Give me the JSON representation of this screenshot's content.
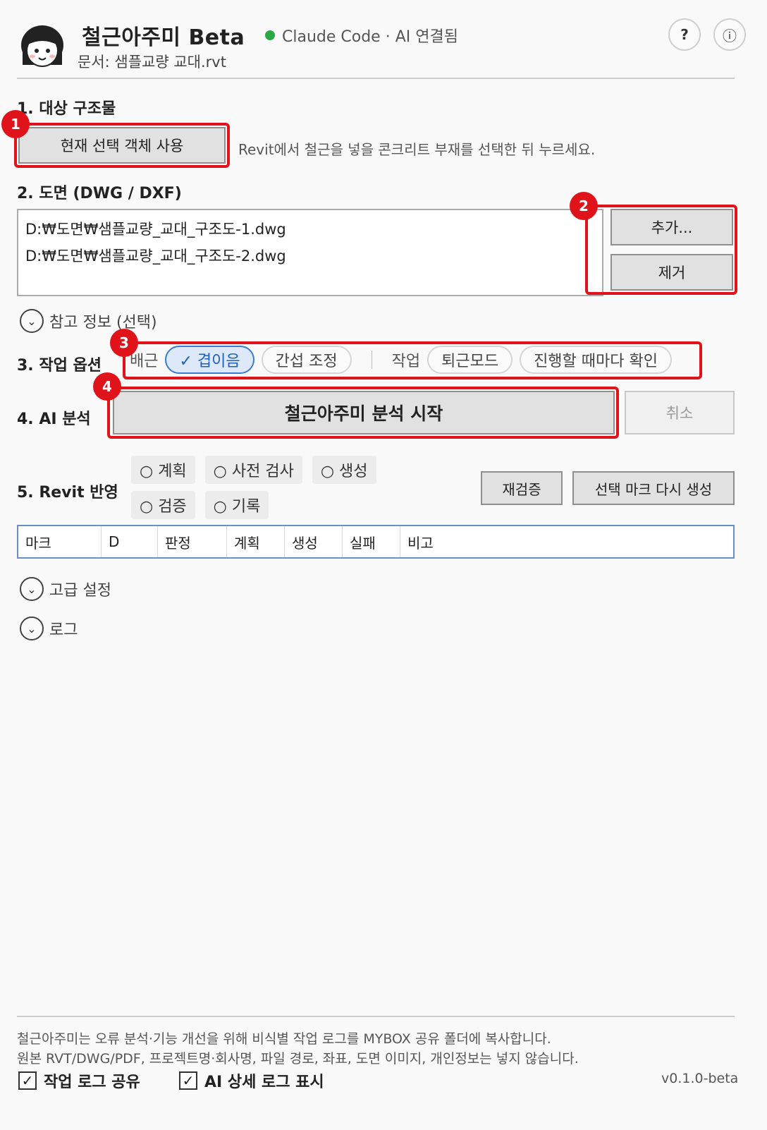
{
  "header": {
    "title": "철근아주미 Beta",
    "status": "Claude Code · AI 연결됨",
    "document": "문서: 샘플교량 교대.rvt",
    "help_label": "?",
    "info_label": "ⓘ",
    "status_color": "#2aa845"
  },
  "section1": {
    "title": "1. 대상 구조물",
    "button": "현재 선택 객체 사용",
    "hint": "Revit에서 철근을 넣을 콘크리트 부재를 선택한 뒤 누르세요."
  },
  "section2": {
    "title": "2. 도면 (DWG / DXF)",
    "files": [
      "D:₩도면₩샘플교량_교대_구조도-1.dwg",
      "D:₩도면₩샘플교량_교대_구조도-2.dwg"
    ],
    "add_button": "추가...",
    "remove_button": "제거"
  },
  "reference": {
    "label": "참고 정보 (선택)"
  },
  "section3": {
    "title": "3. 작업 옵션",
    "rebar_label": "배근",
    "rebar_options": [
      "✓ 겹이음",
      "간섭 조정"
    ],
    "work_label": "작업",
    "work_options": [
      "퇴근모드",
      "진행할 때마다 확인"
    ]
  },
  "section4": {
    "title": "4. AI 분석",
    "start_button": "철근아주미 분석 시작",
    "cancel_button": "취소"
  },
  "section5": {
    "title": "5. Revit 반영",
    "steps": [
      "○ 계획",
      "○ 사전 검사",
      "○ 생성",
      "○ 검증",
      "○ 기록"
    ],
    "reverify_button": "재검증",
    "regen_button": "선택 마크 다시 생성",
    "columns": [
      "마크",
      "D",
      "판정",
      "계획",
      "생성",
      "실패",
      "비고"
    ]
  },
  "advanced": {
    "label": "고급 설정"
  },
  "log": {
    "label": "로그"
  },
  "footer": {
    "notice_line1": "철근아주미는 오류 분석·기능 개선을 위해 비식별 작업 로그를 MYBOX 공유 폴더에 복사합니다.",
    "notice_line2": "원본 RVT/DWG/PDF, 프로젝트명·회사명, 파일 경로, 좌표, 도면 이미지, 개인정보는 넣지 않습니다.",
    "share_log": "작업 로그 공유",
    "ai_detail_log": "AI 상세 로그 표시",
    "version": "v0.1.0-beta"
  },
  "badges": [
    "1",
    "2",
    "3",
    "4"
  ],
  "colors": {
    "highlight": "#e0131b",
    "selected_pill": "#3a7bd5"
  }
}
